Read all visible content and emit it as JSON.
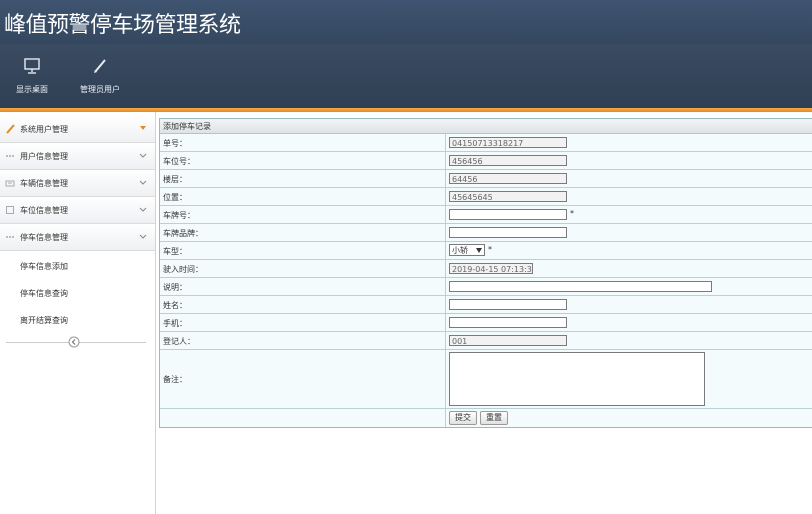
{
  "app": {
    "title": "峰值预警停车场管理系统"
  },
  "toolbar": {
    "items": [
      {
        "label": "显示桌面",
        "icon": "monitor-icon"
      },
      {
        "label": "管理员用户",
        "icon": "pencil-icon"
      }
    ]
  },
  "sidebar": {
    "menus": [
      {
        "label": "系统用户管理",
        "icon": "pencil-icon"
      },
      {
        "label": "用户信息管理",
        "icon": "dots-icon"
      },
      {
        "label": "车辆信息管理",
        "icon": "vehicle-icon"
      },
      {
        "label": "车位信息管理",
        "icon": "box-icon"
      },
      {
        "label": "停车信息管理",
        "icon": "dots-icon"
      }
    ],
    "subitems": [
      "停车信息添加",
      "停车信息查询",
      "离开结算查询"
    ]
  },
  "form": {
    "title": "添加停车记录",
    "fields": {
      "order_no": {
        "label": "单号：",
        "value": "04150713318217"
      },
      "space_no": {
        "label": "车位号：",
        "value": "456456"
      },
      "floor": {
        "label": "楼层：",
        "value": "64456"
      },
      "position": {
        "label": "位置：",
        "value": "45645645"
      },
      "plate": {
        "label": "车牌号：",
        "value": "",
        "required": "*"
      },
      "brand": {
        "label": "车牌品牌：",
        "value": ""
      },
      "car_type": {
        "label": "车型：",
        "value": "小轿",
        "required": "*"
      },
      "entry_time": {
        "label": "驶入时间：",
        "value": "2019-04-15 07:13:3"
      },
      "description": {
        "label": "说明：",
        "value": ""
      },
      "name": {
        "label": "姓名：",
        "value": ""
      },
      "phone": {
        "label": "手机：",
        "value": ""
      },
      "registrar": {
        "label": "登记人：",
        "value": "001"
      },
      "remark": {
        "label": "备注：",
        "value": ""
      }
    },
    "buttons": {
      "submit": "提交",
      "reset": "重置"
    }
  },
  "colors": {
    "header": "#3a4c62",
    "accent": "#f0a040",
    "form_bg": "#f4fbfc"
  }
}
